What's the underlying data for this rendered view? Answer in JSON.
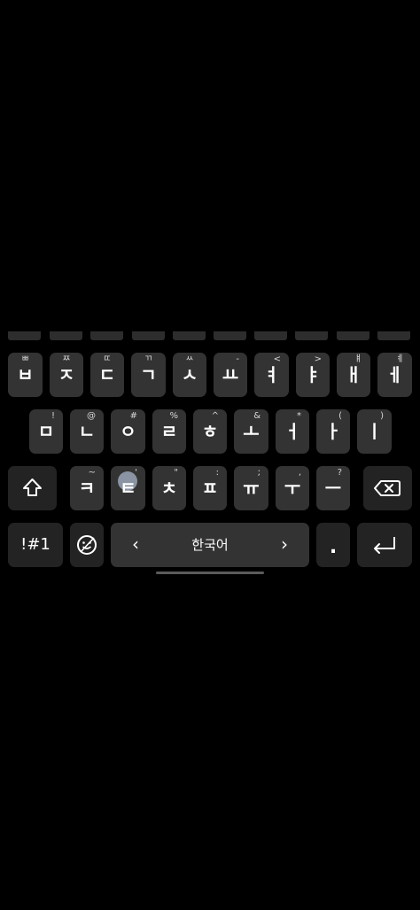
{
  "keyboard": {
    "row1": [
      {
        "main": "ㅂ",
        "hint": "ㅃ"
      },
      {
        "main": "ㅈ",
        "hint": "ㅉ"
      },
      {
        "main": "ㄷ",
        "hint": "ㄸ"
      },
      {
        "main": "ㄱ",
        "hint": "ㄲ"
      },
      {
        "main": "ㅅ",
        "hint": "ㅆ"
      },
      {
        "main": "ㅛ",
        "hint": "-"
      },
      {
        "main": "ㅕ",
        "hint": "<"
      },
      {
        "main": "ㅑ",
        "hint": ">"
      },
      {
        "main": "ㅐ",
        "hint": "ㅒ"
      },
      {
        "main": "ㅔ",
        "hint": "ㅖ"
      }
    ],
    "row2": [
      {
        "main": "ㅁ",
        "hint": "!"
      },
      {
        "main": "ㄴ",
        "hint": "@"
      },
      {
        "main": "ㅇ",
        "hint": "#"
      },
      {
        "main": "ㄹ",
        "hint": "%"
      },
      {
        "main": "ㅎ",
        "hint": "^"
      },
      {
        "main": "ㅗ",
        "hint": "&"
      },
      {
        "main": "ㅓ",
        "hint": "*"
      },
      {
        "main": "ㅏ",
        "hint": "("
      },
      {
        "main": "ㅣ",
        "hint": ")"
      }
    ],
    "row3": [
      {
        "main": "ㅋ",
        "hint": "~"
      },
      {
        "main": "ㅌ",
        "hint": "'"
      },
      {
        "main": "ㅊ",
        "hint": "\""
      },
      {
        "main": "ㅍ",
        "hint": ":"
      },
      {
        "main": "ㅠ",
        "hint": ";"
      },
      {
        "main": "ㅜ",
        "hint": ","
      },
      {
        "main": "ㅡ",
        "hint": "?"
      }
    ],
    "symbols_label": "!#1",
    "emoji_icon": "emoji-settings-icon",
    "space": {
      "label": "한국어",
      "left_arrow": "‹",
      "right_arrow": "›"
    },
    "period": ".",
    "shift_icon": "shift-arrow-icon",
    "backspace_icon": "backspace-icon",
    "enter_icon": "enter-return-icon"
  },
  "colors": {
    "background": "#000000",
    "key": "#333333",
    "key_dark": "#232323",
    "pressed_bubble": "#9aa6b6"
  }
}
